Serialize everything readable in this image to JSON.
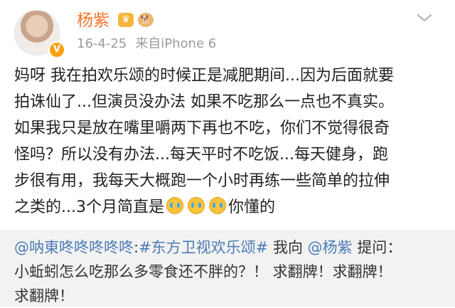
{
  "post": {
    "username": "杨紫",
    "verified_badge": "V",
    "badges": [
      {
        "name": "crown-badge-icon",
        "glyph": "♛"
      },
      {
        "name": "dog-emoji-badge-icon",
        "glyph": "🐕"
      }
    ],
    "timestamp": "16-4-25",
    "source": "来自iPhone 6",
    "menu_icon": "chevron-down-icon",
    "body_lines": [
      "妈呀 我在拍欢乐颂的时候正是减肥期间...因为后面就要",
      "拍诛仙了...但演员没办法 如果不吃那么一点也不真实。",
      "如果我只是放在嘴里嚼两下再也不吃，你们不觉得很奇",
      "怪吗？所以没有办法...每天平时不吃饭...每天健身，跑",
      "步很有用，我每天大概跑一个小时再练一些简单的拉伸"
    ],
    "body_last_line_prefix": "之类的...3个月简直是",
    "body_last_line_suffix": "你懂的",
    "crying_emoji_count": 3
  },
  "repost": {
    "mention_user": "@呐東咚咚咚咚咚",
    "separator": ":",
    "hashtag": "#东方卫视欢乐颂#",
    "text_before_mention": " 我向 ",
    "mention_target": "@杨紫",
    "text_after_mention": " 提问：",
    "line2": "小蚯蚓怎么吃那么多零食还不胖的？！ 求翻牌！求翻牌！",
    "line3": "求翻牌！"
  },
  "colors": {
    "username": "#f7762b",
    "meta": "#9b9b9b",
    "link": "#4b7bb5",
    "repost_bg": "#f2f2f2"
  }
}
